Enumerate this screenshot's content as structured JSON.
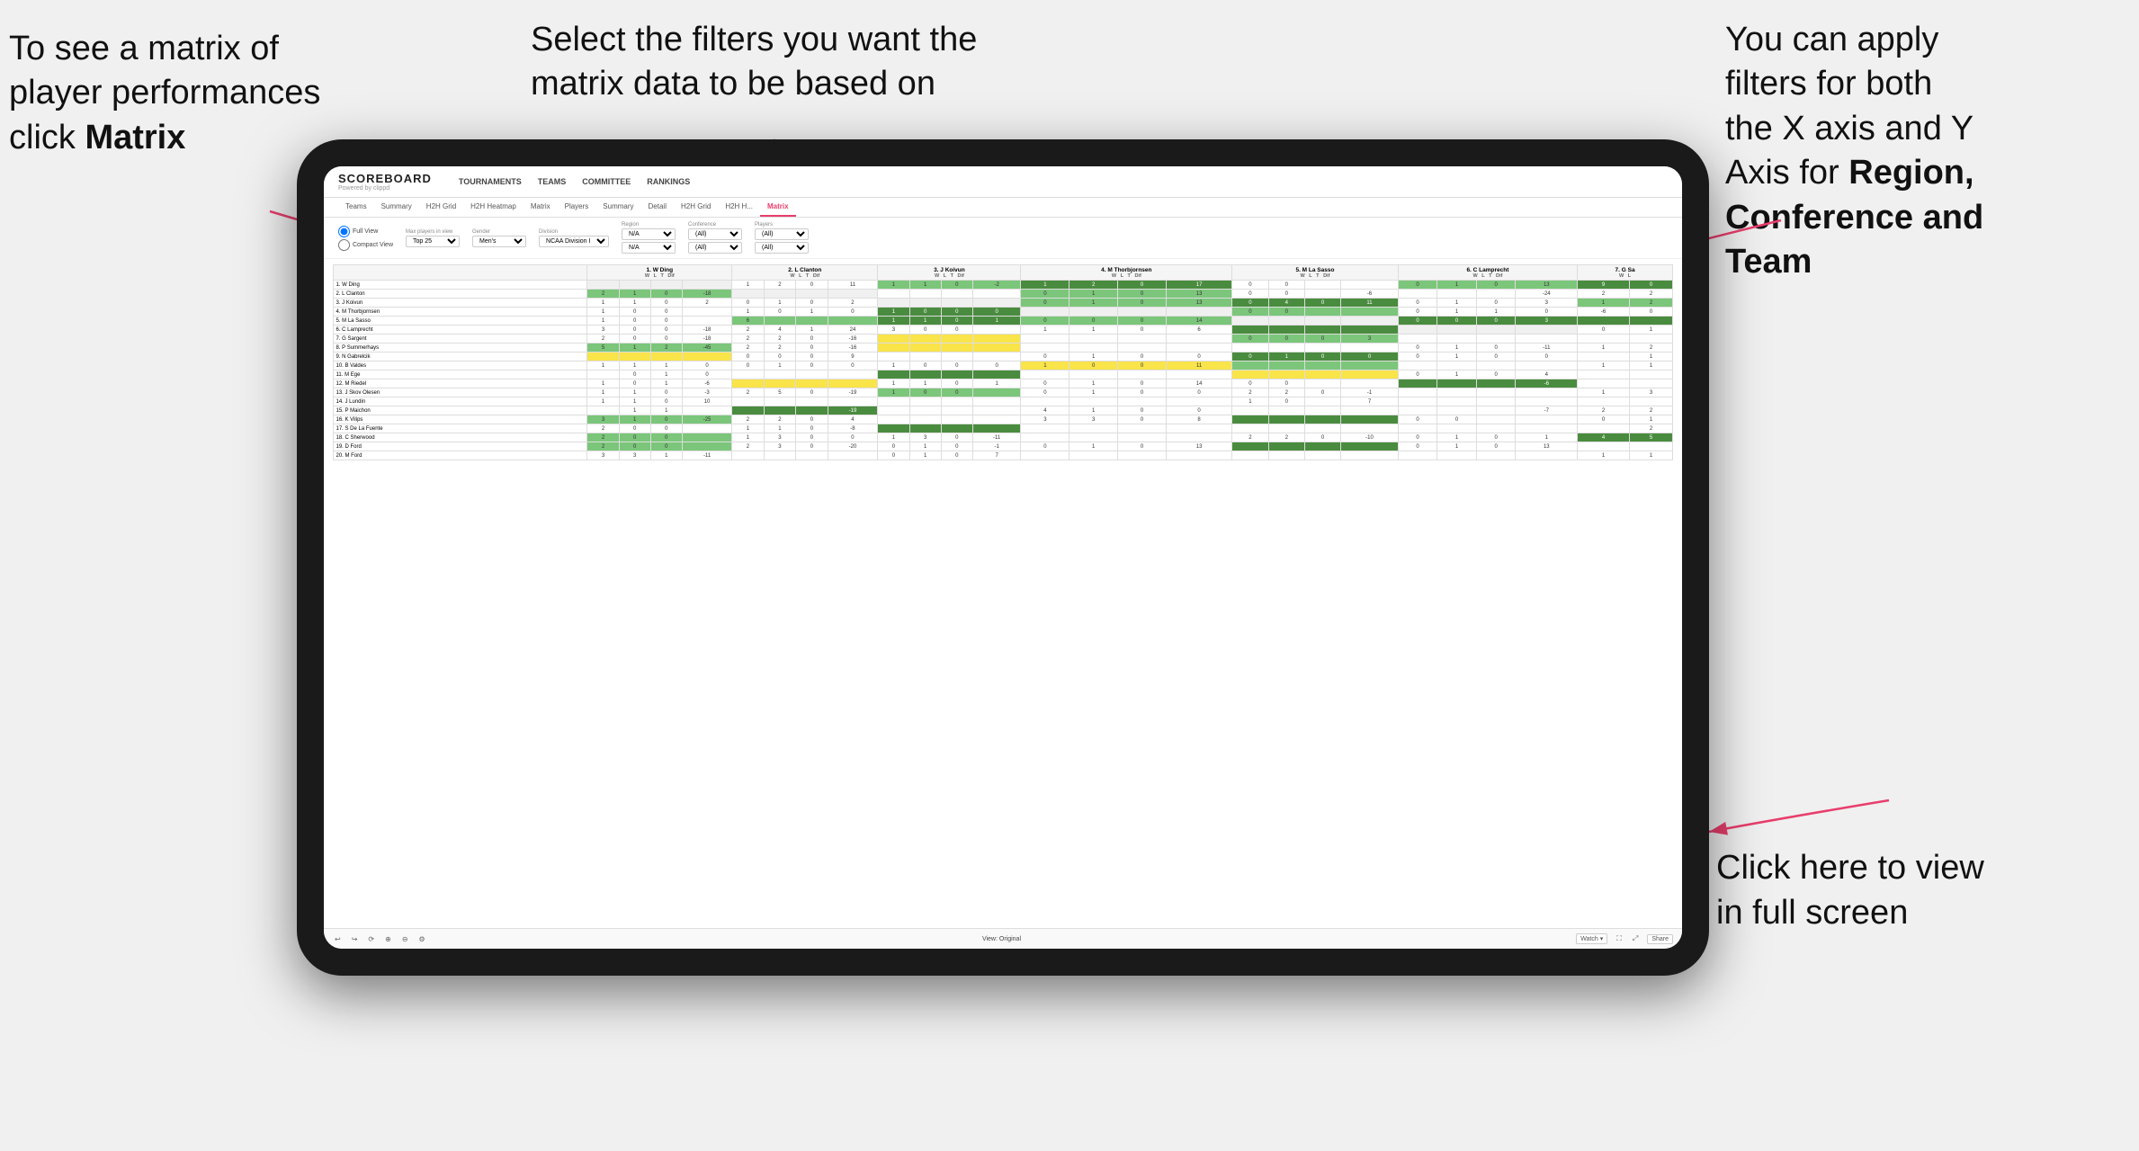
{
  "annotations": {
    "topleft": {
      "line1": "To see a matrix of",
      "line2": "player performances",
      "line3_plain": "click ",
      "line3_bold": "Matrix"
    },
    "topmid": {
      "text": "Select the filters you want the matrix data to be based on"
    },
    "topright": {
      "line1": "You  can apply",
      "line2": "filters for both",
      "line3": "the X axis and Y",
      "line4_plain": "Axis for ",
      "line4_bold": "Region,",
      "line5_bold": "Conference and",
      "line6_bold": "Team"
    },
    "bottomright": {
      "line1": "Click here to view",
      "line2": "in full screen"
    }
  },
  "nav": {
    "logo": "SCOREBOARD",
    "logo_sub": "Powered by clippd",
    "items": [
      "TOURNAMENTS",
      "TEAMS",
      "COMMITTEE",
      "RANKINGS"
    ]
  },
  "subtabs": [
    "Teams",
    "Summary",
    "H2H Grid",
    "H2H Heatmap",
    "Matrix",
    "Players",
    "Summary",
    "Detail",
    "H2H Grid",
    "H2H H...",
    "Matrix"
  ],
  "active_tab": "Matrix",
  "filters": {
    "view_options": [
      "Full View",
      "Compact View"
    ],
    "max_players_label": "Max players in view",
    "max_players_value": "Top 25",
    "gender_label": "Gender",
    "gender_value": "Men's",
    "division_label": "Division",
    "division_value": "NCAA Division I",
    "region_label": "Region",
    "region_value": "N/A",
    "conference_label": "Conference",
    "conference_values": [
      "(All)",
      "(All)"
    ],
    "players_label": "Players",
    "players_values": [
      "(All)",
      "(All)"
    ]
  },
  "matrix": {
    "col_headers": [
      {
        "num": "1",
        "name": "W Ding"
      },
      {
        "num": "2",
        "name": "L Clanton"
      },
      {
        "num": "3",
        "name": "J Koivun"
      },
      {
        "num": "4",
        "name": "M Thorbjornsen"
      },
      {
        "num": "5",
        "name": "M La Sasso"
      },
      {
        "num": "6",
        "name": "C Lamprecht"
      },
      {
        "num": "7",
        "name": "G Sa"
      }
    ],
    "rows": [
      {
        "num": "1",
        "name": "W Ding"
      },
      {
        "num": "2",
        "name": "L Clanton"
      },
      {
        "num": "3",
        "name": "J Koivun"
      },
      {
        "num": "4",
        "name": "M Thorbjornsen"
      },
      {
        "num": "5",
        "name": "M La Sasso"
      },
      {
        "num": "6",
        "name": "C Lamprecht"
      },
      {
        "num": "7",
        "name": "G Sargent"
      },
      {
        "num": "8",
        "name": "P Summerhays"
      },
      {
        "num": "9",
        "name": "N Gabrelcik"
      },
      {
        "num": "10",
        "name": "B Valdes"
      },
      {
        "num": "11",
        "name": "M Ege"
      },
      {
        "num": "12",
        "name": "M Riedel"
      },
      {
        "num": "13",
        "name": "J Skov Olesen"
      },
      {
        "num": "14",
        "name": "J Lundin"
      },
      {
        "num": "15",
        "name": "P Maichon"
      },
      {
        "num": "16",
        "name": "K Vilips"
      },
      {
        "num": "17",
        "name": "S De La Fuente"
      },
      {
        "num": "18",
        "name": "C Sherwood"
      },
      {
        "num": "19",
        "name": "D Ford"
      },
      {
        "num": "20",
        "name": "M Ford"
      }
    ]
  },
  "toolbar": {
    "view_original": "View: Original",
    "watch": "Watch ▾",
    "share": "Share"
  }
}
